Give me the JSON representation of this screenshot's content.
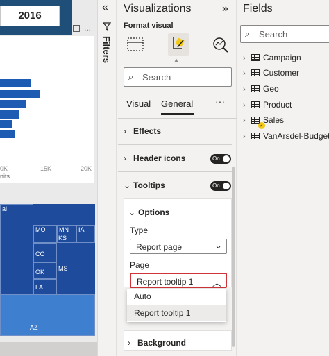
{
  "canvas": {
    "slicer_value": "2016",
    "ellipsis": "...",
    "bar_chart": {
      "x_ticks": [
        "0K",
        "15K",
        "20K"
      ],
      "x_label": "nits"
    },
    "treemap_labels": [
      "al",
      "MO",
      "MN",
      "IA",
      "CO",
      "KS",
      "OK",
      "MS",
      "LA",
      "AZ"
    ]
  },
  "filters": {
    "label": "Filters",
    "chevron": "«",
    "icon": "filter-icon"
  },
  "visualizations": {
    "title": "Visualizations",
    "expand": "»",
    "format_visual": "Format visual",
    "search_placeholder": "Search",
    "tabs": {
      "visual": "Visual",
      "general": "General",
      "more": "···"
    },
    "sections": {
      "effects": "Effects",
      "header_icons": "Header icons",
      "header_icons_toggle": "On",
      "tooltips": "Tooltips",
      "tooltips_toggle": "On",
      "options": "Options",
      "type_label": "Type",
      "type_value": "Report page",
      "page_label": "Page",
      "page_value": "Report tooltip 1",
      "background": "Background"
    },
    "dropdown_options": [
      "Auto",
      "Report tooltip 1"
    ]
  },
  "fields": {
    "title": "Fields",
    "search_placeholder": "Search",
    "tables": [
      "Campaign",
      "Customer",
      "Geo",
      "Product",
      "Sales",
      "VanArsdel-Budget"
    ]
  },
  "colors": {
    "accent_blue": "#1e5cb3",
    "slicer_navy": "#1f4e79",
    "highlight_red": "#d13438",
    "toggle_dark": "#252423"
  }
}
